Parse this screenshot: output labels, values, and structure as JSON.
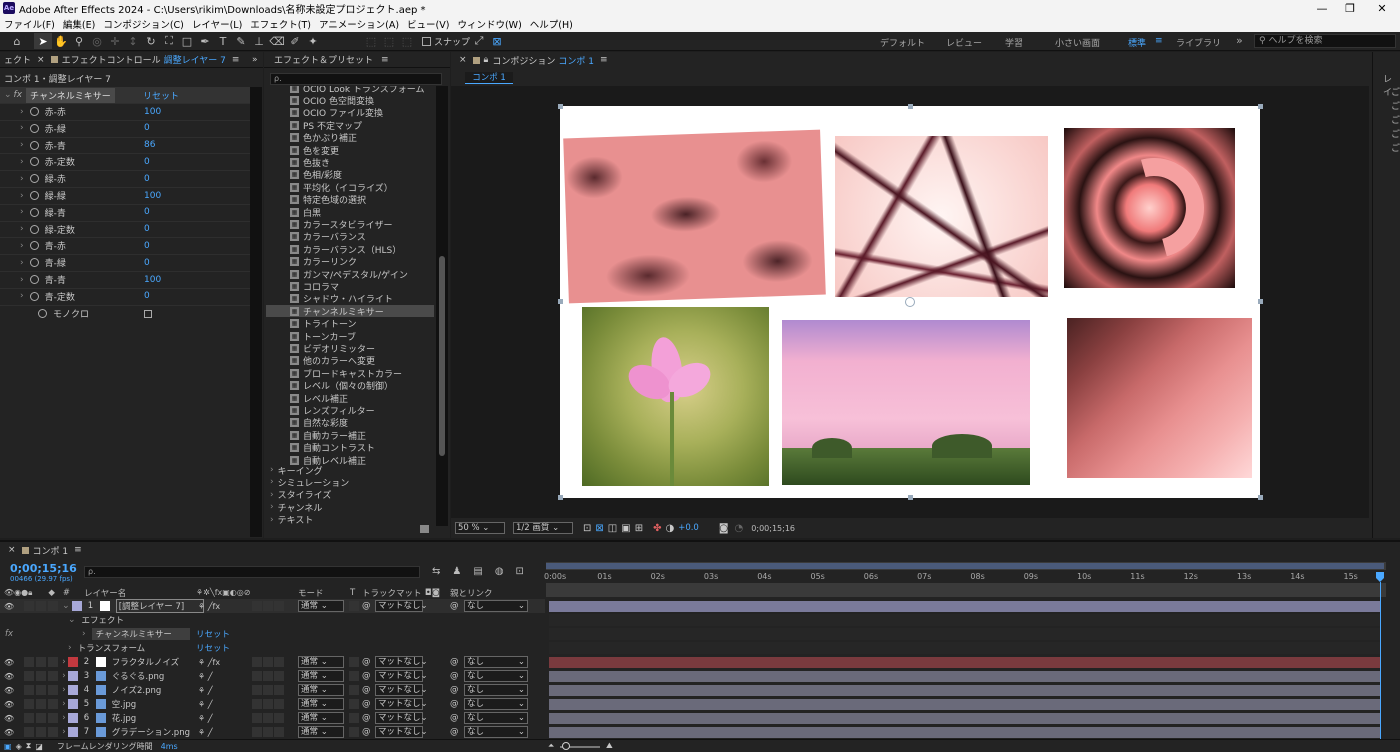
{
  "window": {
    "title": "Adobe After Effects 2024 - C:\\Users\\rikim\\Downloads\\名称未設定プロジェクト.aep *",
    "logo": "Ae"
  },
  "menu": [
    "ファイル(F)",
    "編集(E)",
    "コンポジション(C)",
    "レイヤー(L)",
    "エフェクト(T)",
    "アニメーション(A)",
    "ビュー(V)",
    "ウィンドウ(W)",
    "ヘルプ(H)"
  ],
  "toolbar": {
    "snap_label": "スナップ",
    "workspaces": [
      "デフォルト",
      "レビュー",
      "学習",
      "小さい画面",
      "標準",
      "ライブラリ"
    ],
    "active_workspace": "標準",
    "help_search_placeholder": "ヘルプを検索",
    "more": "»"
  },
  "effect_controls": {
    "tab_left": "ェクト",
    "tab_title": "エフェクトコントロール",
    "tab_layer": "調整レイヤー 7",
    "breadcrumb": "コンポ 1・調整レイヤー 7",
    "effect_name": "チャンネルミキサー",
    "reset": "リセット",
    "params": [
      {
        "name": "赤-赤",
        "value": "100"
      },
      {
        "name": "赤-緑",
        "value": "0"
      },
      {
        "name": "赤-青",
        "value": "86"
      },
      {
        "name": "赤-定数",
        "value": "0"
      },
      {
        "name": "緑-赤",
        "value": "0"
      },
      {
        "name": "緑-緑",
        "value": "100"
      },
      {
        "name": "緑-青",
        "value": "0"
      },
      {
        "name": "緑-定数",
        "value": "0"
      },
      {
        "name": "青-赤",
        "value": "0"
      },
      {
        "name": "青-緑",
        "value": "0"
      },
      {
        "name": "青-青",
        "value": "100"
      },
      {
        "name": "青-定数",
        "value": "0"
      }
    ],
    "mono_label": "モノクロ"
  },
  "effects_presets": {
    "title": "エフェクト＆プリセット",
    "search_placeholder": "ρ.",
    "items": [
      "OCIO Look トランスフォーム",
      "OCIO 色空間変換",
      "OCIO ファイル変換",
      "PS 不定マップ",
      "色かぶり補正",
      "色を変更",
      "色抜き",
      "色相/彩度",
      "平均化（イコライズ）",
      "特定色域の選択",
      "白黒",
      "カラースタビライザー",
      "カラーバランス",
      "カラーバランス（HLS）",
      "カラーリンク",
      "ガンマ/ペデスタル/ゲイン",
      "コロラマ",
      "シャドウ・ハイライト",
      "チャンネルミキサー",
      "トライトーン",
      "トーンカーブ",
      "ビデオリミッター",
      "他のカラーへ変更",
      "ブロードキャストカラー",
      "レベル（個々の制御）",
      "レベル補正",
      "レンズフィルター",
      "自然な彩度",
      "自動カラー補正",
      "自動コントラスト",
      "自動レベル補正"
    ],
    "selected": "チャンネルミキサー",
    "categories": [
      "キーイング",
      "シミュレーション",
      "スタイライズ",
      "チャンネル",
      "テキスト"
    ]
  },
  "composition": {
    "tab_title": "コンポジション",
    "tab_comp": "コンポ 1",
    "sub_tab": "コンポ 1",
    "zoom": "50 %",
    "resolution": "1/2 画質",
    "exposure": "+0.0",
    "timecode": "0;00;15;16"
  },
  "timeline": {
    "tab": "コンポ 1",
    "timecode": "0;00;15;16",
    "frame_info": "00466 (29.97 fps)",
    "search_placeholder": "ρ.",
    "col_layer_name": "レイヤー名",
    "col_mode": "モード",
    "col_t": "T",
    "col_trackmatte": "トラックマット",
    "col_parent": "親とリンク",
    "ruler": [
      "0:00s",
      "01s",
      "02s",
      "03s",
      "04s",
      "05s",
      "06s",
      "07s",
      "08s",
      "09s",
      "10s",
      "11s",
      "12s",
      "13s",
      "14s",
      "15s"
    ],
    "layers": [
      {
        "num": "1",
        "name": "[調整レイヤー 7]",
        "mode": "通常",
        "matte": "マットなし",
        "parent": "なし",
        "color": "#a7a8d8",
        "selected": true
      },
      {
        "num": "2",
        "name": "フラクタルノイズ",
        "mode": "通常",
        "matte": "マットなし",
        "parent": "なし",
        "color": "#c2393f"
      },
      {
        "num": "3",
        "name": "ぐるぐる.png",
        "mode": "通常",
        "matte": "マットなし",
        "parent": "なし",
        "color": "#a7a8d8"
      },
      {
        "num": "4",
        "name": "ノイズ2.png",
        "mode": "通常",
        "matte": "マットなし",
        "parent": "なし",
        "color": "#a7a8d8"
      },
      {
        "num": "5",
        "name": "空.jpg",
        "mode": "通常",
        "matte": "マットなし",
        "parent": "なし",
        "color": "#a7a8d8"
      },
      {
        "num": "6",
        "name": "花.jpg",
        "mode": "通常",
        "matte": "マットなし",
        "parent": "なし",
        "color": "#a7a8d8"
      },
      {
        "num": "7",
        "name": "グラデーション.png",
        "mode": "通常",
        "matte": "マットなし",
        "parent": "なし",
        "color": "#a7a8d8"
      }
    ],
    "effect_group": "エフェクト",
    "effect_sub": "チャンネルミキサー",
    "effect_reset": "リセット",
    "transform": "トランスフォーム",
    "transform_reset": "リセット",
    "fx_label": "fx",
    "render_time_label": "フレームレンダリング時間",
    "render_time": "4ms"
  }
}
